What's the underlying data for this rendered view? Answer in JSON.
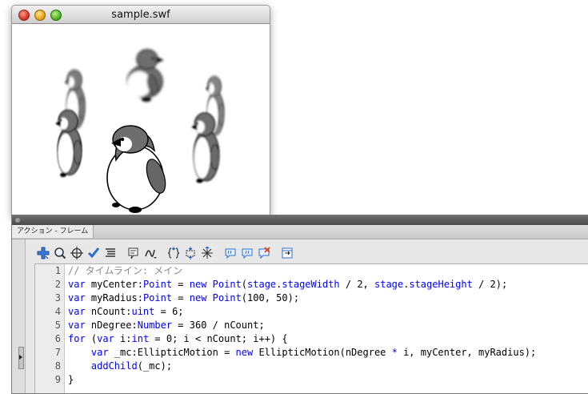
{
  "window": {
    "title": "sample.swf"
  },
  "panel": {
    "tab_label": "アクション - フレーム"
  },
  "toolbar": {
    "icons": [
      "add-statement-icon",
      "find-icon",
      "target-path-icon",
      "check-syntax-icon",
      "auto-format-icon",
      "code-hint-icon",
      "debug-options-icon",
      "collapse-braces-icon",
      "collapse-selection-icon",
      "expand-all-icon",
      "apply-block-comment-icon",
      "apply-line-comment-icon",
      "remove-comment-icon",
      "show-hide-toolbox-icon"
    ]
  },
  "editor": {
    "line_numbers": [
      "1",
      "2",
      "3",
      "4",
      "5",
      "6",
      "7",
      "8",
      "9"
    ],
    "lines": [
      [
        {
          "t": "// タイムライン: メイン",
          "c": "comment"
        }
      ],
      [
        {
          "t": "var",
          "c": "kw"
        },
        {
          "t": " myCenter:"
        },
        {
          "t": "Point",
          "c": "kw"
        },
        {
          "t": " = "
        },
        {
          "t": "new",
          "c": "kw"
        },
        {
          "t": " "
        },
        {
          "t": "Point",
          "c": "kw"
        },
        {
          "t": "("
        },
        {
          "t": "stage",
          "c": "kw"
        },
        {
          "t": "."
        },
        {
          "t": "stageWidth",
          "c": "kw"
        },
        {
          "t": " / 2, "
        },
        {
          "t": "stage",
          "c": "kw"
        },
        {
          "t": "."
        },
        {
          "t": "stageHeight",
          "c": "kw"
        },
        {
          "t": " / 2);"
        }
      ],
      [
        {
          "t": "var",
          "c": "kw"
        },
        {
          "t": " myRadius:"
        },
        {
          "t": "Point",
          "c": "kw"
        },
        {
          "t": " = "
        },
        {
          "t": "new",
          "c": "kw"
        },
        {
          "t": " "
        },
        {
          "t": "Point",
          "c": "kw"
        },
        {
          "t": "(100, 50);"
        }
      ],
      [
        {
          "t": "var",
          "c": "kw"
        },
        {
          "t": " nCount:"
        },
        {
          "t": "uint",
          "c": "kw"
        },
        {
          "t": " = 6;"
        }
      ],
      [
        {
          "t": "var",
          "c": "kw"
        },
        {
          "t": " nDegree:"
        },
        {
          "t": "Number",
          "c": "kw"
        },
        {
          "t": " = 360 / nCount;"
        }
      ],
      [
        {
          "t": "for",
          "c": "kw"
        },
        {
          "t": " ("
        },
        {
          "t": "var",
          "c": "kw"
        },
        {
          "t": " i:"
        },
        {
          "t": "int",
          "c": "kw"
        },
        {
          "t": " = 0; i < nCount; i++) {"
        }
      ],
      [
        {
          "t": "    "
        },
        {
          "t": "var",
          "c": "kw"
        },
        {
          "t": " _mc:EllipticMotion = "
        },
        {
          "t": "new",
          "c": "kw"
        },
        {
          "t": " EllipticMotion(nDegree "
        },
        {
          "t": "*",
          "c": "kw"
        },
        {
          "t": " i, myCenter, myRadius);"
        }
      ],
      [
        {
          "t": "    "
        },
        {
          "t": "addChild",
          "c": "kw"
        },
        {
          "t": "(_mc);"
        }
      ],
      [
        {
          "t": "}"
        }
      ]
    ]
  },
  "stage": {
    "sprites": [
      "penguin",
      "penguin",
      "penguin",
      "penguin",
      "penguin",
      "penguin"
    ]
  }
}
